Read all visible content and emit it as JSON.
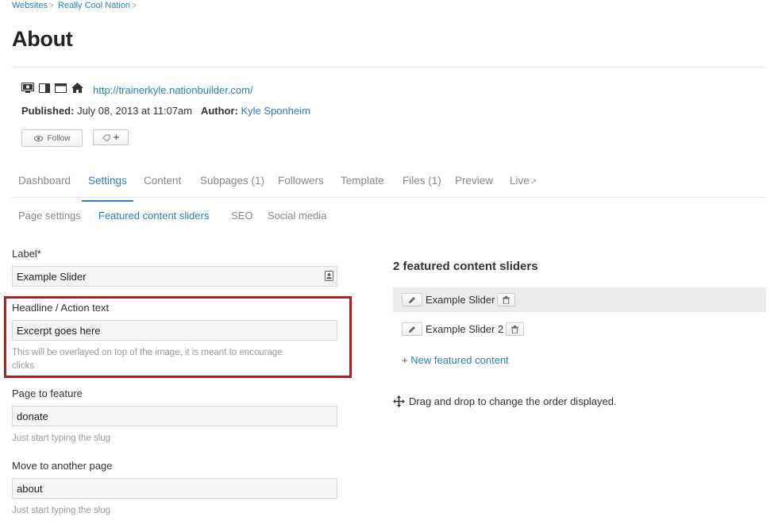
{
  "breadcrumb": {
    "items": [
      "Websites",
      "Really Cool Nation"
    ]
  },
  "page": {
    "title": "About"
  },
  "meta": {
    "site_url": "http://trainerkyle.nationbuilder.com/",
    "published_label": "Published:",
    "published_value": " July 08, 2013 at 11:07am",
    "author_label": "Author:",
    "author_name": "Kyle Sponheim"
  },
  "actions": {
    "follow_label": "Follow",
    "tag_plus": "+"
  },
  "tabs": {
    "dashboard": "Dashboard",
    "settings": "Settings",
    "content": "Content",
    "subpages": "Subpages (1)",
    "followers": "Followers",
    "template": "Template",
    "files": "Files (1)",
    "preview": "Preview",
    "live": "Live"
  },
  "subtabs": {
    "page_settings": "Page settings",
    "featured": "Featured content sliders",
    "seo": "SEO",
    "social": "Social media"
  },
  "form": {
    "label_label": "Label*",
    "label_value": "Example Slider",
    "headline_label": "Headline / Action text",
    "headline_value": "Excerpt goes here",
    "headline_hint_line1": "This will be overlayed on top of the image, it is meant to encourage",
    "headline_hint_line2": "clicks",
    "feature_label": "Page to feature",
    "feature_value": "donate",
    "feature_hint": "Just start typing the slug",
    "move_label": "Move to another page",
    "move_value": "about",
    "move_hint": "Just start typing the slug"
  },
  "sliders": {
    "title": "2 featured content sliders",
    "items": [
      "Example Slider",
      "Example Slider 2"
    ],
    "new_prefix": "+ ",
    "new_label": "New featured content",
    "drag_hint": "Drag and drop to change the order displayed."
  },
  "colors": {
    "link": "#2a7fb8",
    "highlight": "#b41e23"
  },
  "icons": [
    "screen-icon",
    "sidebar-layout-icon",
    "browser-window-icon",
    "home-icon",
    "eye-icon",
    "tag-icon",
    "id-card-icon",
    "pencil-icon",
    "trash-icon",
    "move-arrows-icon",
    "external-link-icon"
  ]
}
